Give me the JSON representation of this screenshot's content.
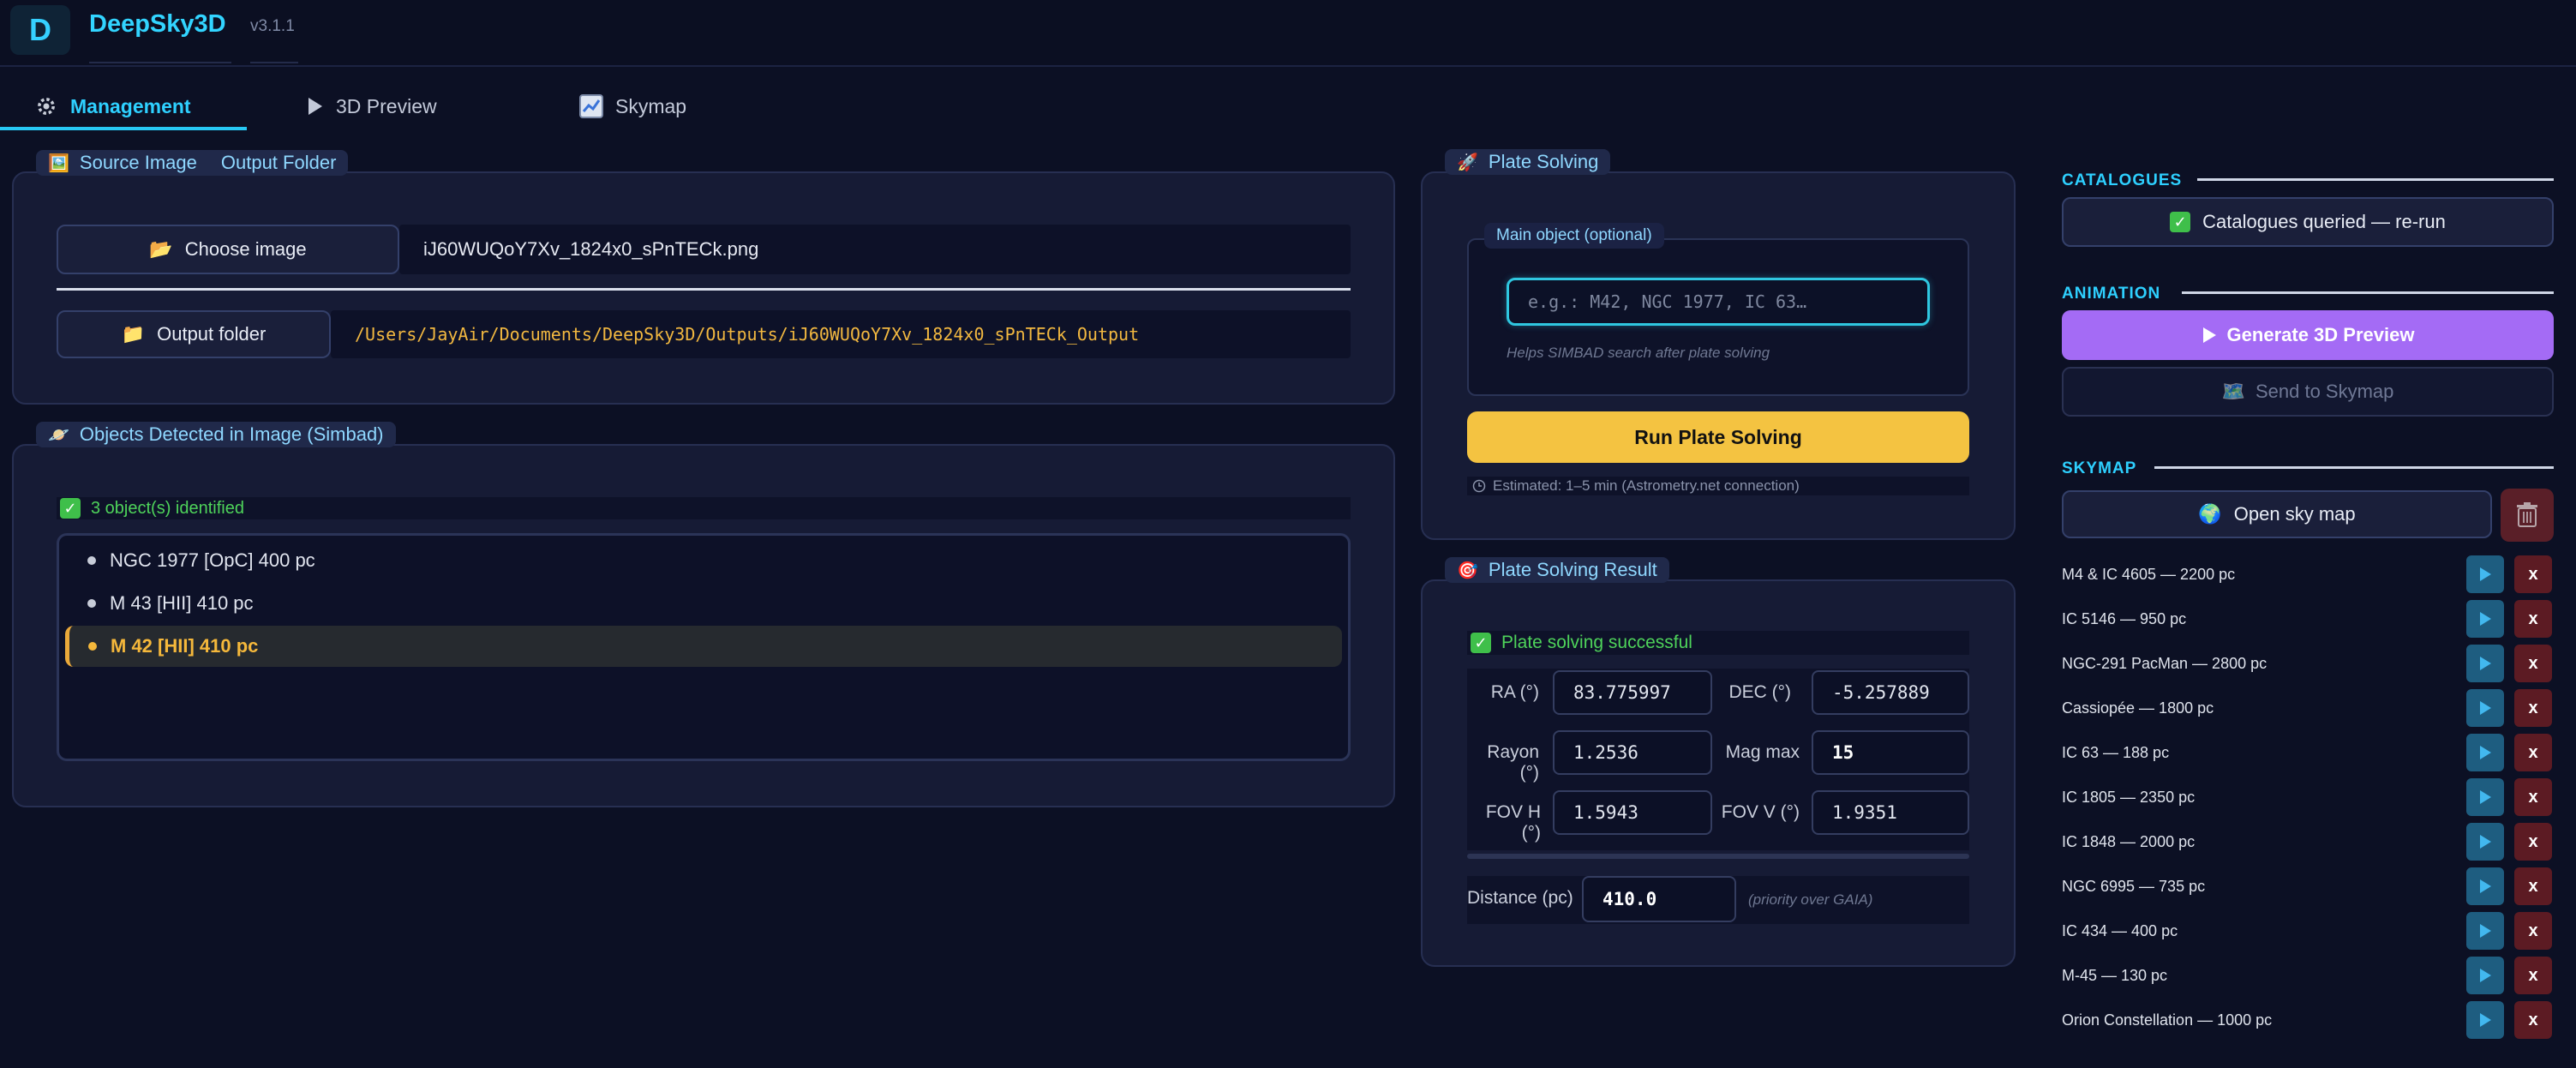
{
  "app": {
    "logo_letter": "D",
    "title": "DeepSky3D",
    "version": "v3.1.1"
  },
  "tabs": [
    {
      "label": "Management",
      "icon": "gear-icon",
      "active": true
    },
    {
      "label": "3D Preview",
      "icon": "play-icon",
      "active": false
    },
    {
      "label": "Skymap",
      "icon": "chart-icon",
      "active": false
    }
  ],
  "source": {
    "legend_source": "Source Image",
    "legend_output": "Output Folder",
    "choose_label": "Choose image",
    "filename": "iJ60WUQoY7Xv_1824x0_sPnTECk.png",
    "output_label": "Output folder",
    "output_path": "/Users/JayAir/Documents/DeepSky3D/Outputs/iJ60WUQoY7Xv_1824x0_sPnTECk_Output"
  },
  "objects": {
    "legend": "Objects Detected in Image (Simbad)",
    "status": "3 object(s) identified",
    "items": [
      {
        "label": "NGC  1977  [OpC]  400 pc",
        "selected": false
      },
      {
        "label": "M  43  [HII]  410 pc",
        "selected": false
      },
      {
        "label": "M  42  [HII]  410 pc",
        "selected": true
      }
    ]
  },
  "plate": {
    "legend": "Plate Solving",
    "main_object_legend": "Main object (optional)",
    "placeholder": "e.g.: M42, NGC 1977, IC 63…",
    "hint": "Helps SIMBAD search after plate solving",
    "run_label": "Run Plate Solving",
    "estimate": "Estimated: 1–5 min (Astrometry.net connection)"
  },
  "result": {
    "legend": "Plate Solving Result",
    "status": "Plate solving successful",
    "fields": {
      "ra_label": "RA (°)",
      "ra": "83.775997",
      "dec_label": "DEC (°)",
      "dec": "-5.257889",
      "rayon_label": "Rayon (°)",
      "rayon": "1.2536",
      "magmax_label": "Mag max",
      "magmax": "15",
      "fovh_label": "FOV H (°)",
      "fovh": "1.5943",
      "fovv_label": "FOV V (°)",
      "fovv": "1.9351"
    },
    "distance_label": "Distance (pc)",
    "distance": "410.0",
    "distance_note": "(priority over GAIA)"
  },
  "catalogues": {
    "title": "CATALOGUES",
    "button": "Catalogues queried — re-run"
  },
  "animation": {
    "title": "ANIMATION",
    "generate": "Generate 3D Preview",
    "send": "Send to Skymap"
  },
  "skymap": {
    "title": "SKYMAP",
    "open": "Open sky map",
    "items": [
      "M4 & IC 4605  —  2200 pc",
      "IC 5146  —  950 pc",
      "NGC-291 PacMan  —  2800 pc",
      "Cassiopée  —  1800 pc",
      "IC  63  —  188 pc",
      "IC 1805  —  2350 pc",
      "IC 1848  —  2000 pc",
      "NGC  6995  —  735 pc",
      "IC  434  —  400 pc",
      "M-45  —  130 pc",
      "Orion Constellation  —  1000 pc"
    ],
    "delete_label": "x"
  },
  "colors": {
    "accent": "#2ed0ff",
    "warning": "#f4c341",
    "purple": "#a46bf5",
    "success": "#3fbf4a",
    "danger": "#5c1b23"
  }
}
